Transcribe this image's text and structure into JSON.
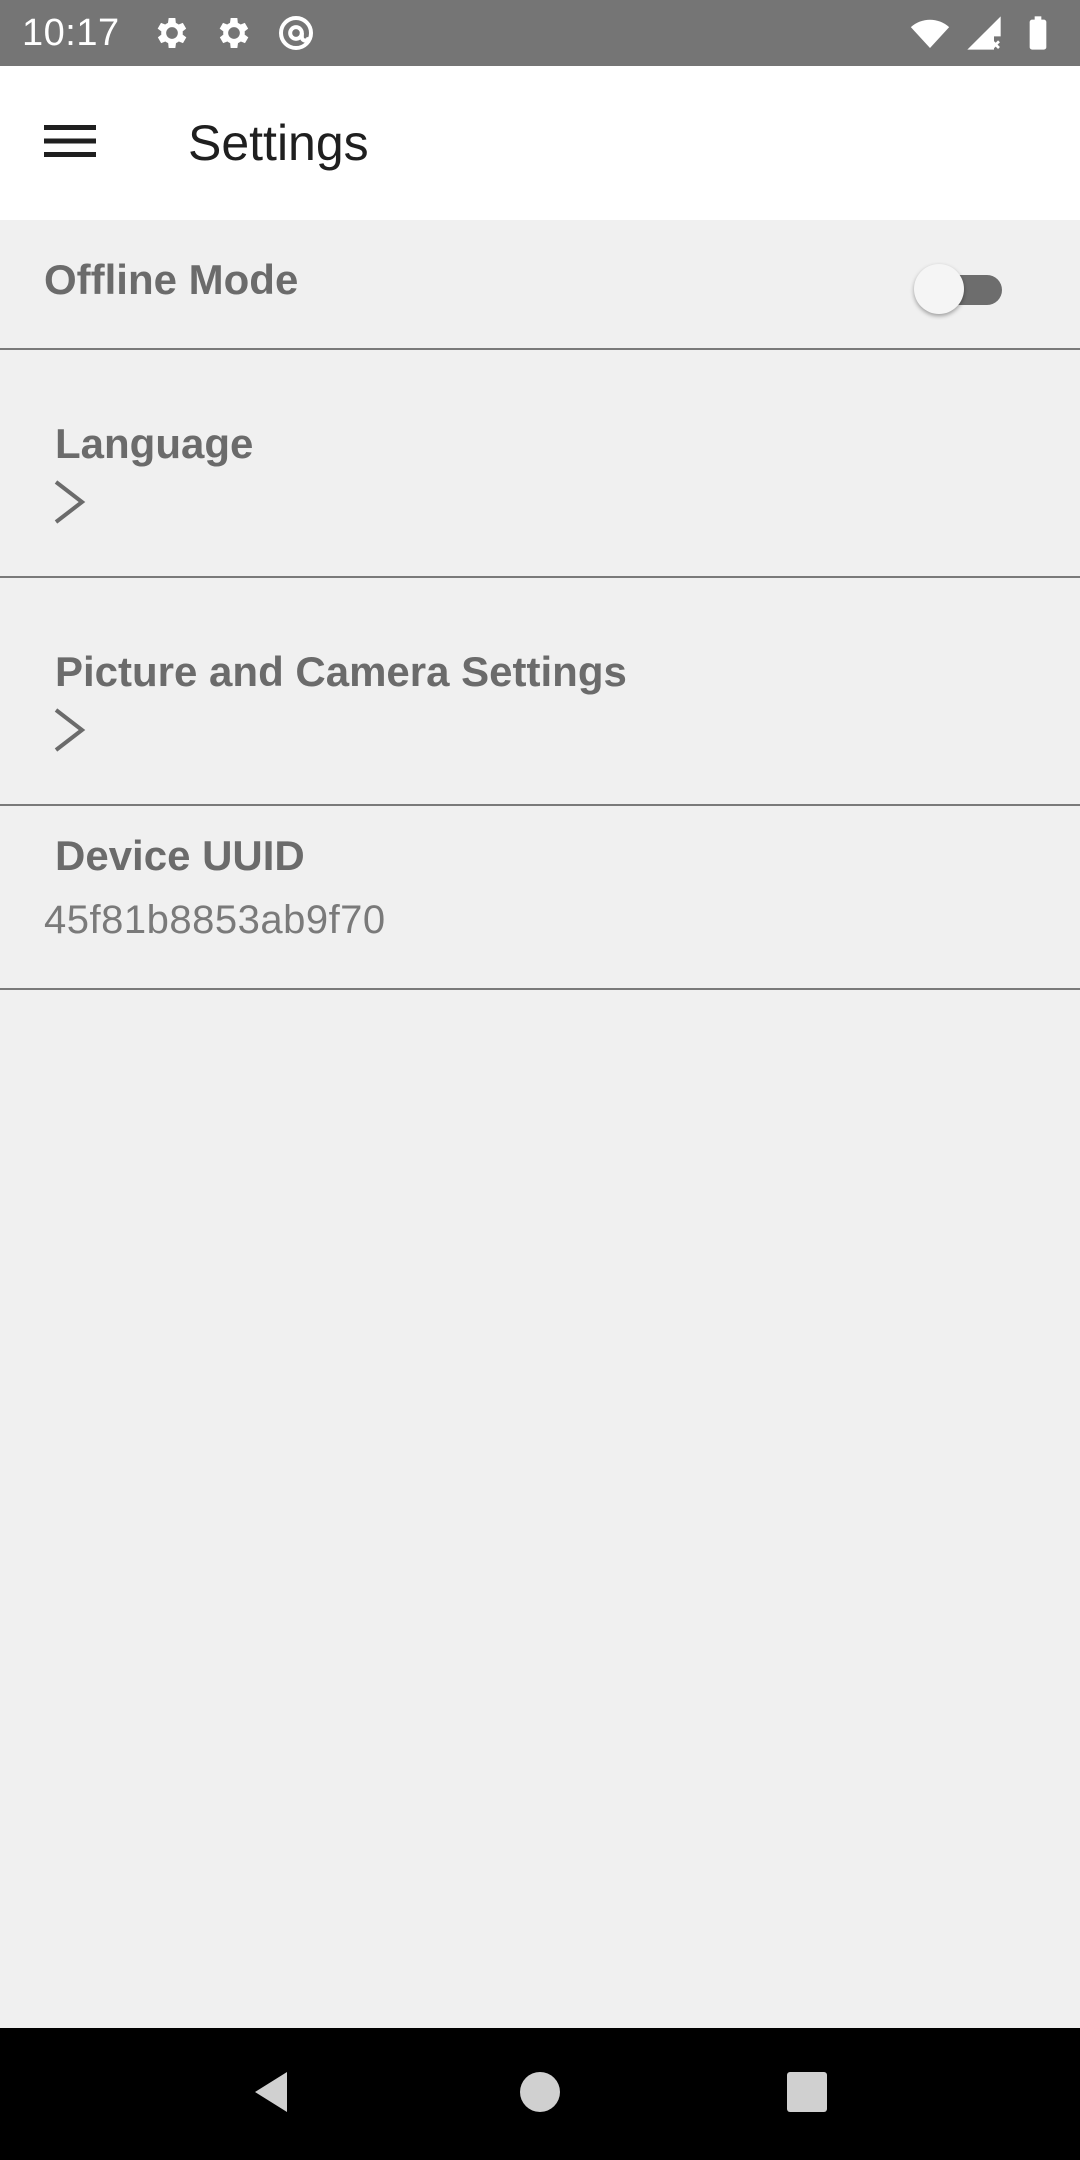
{
  "status_bar": {
    "time": "10:17",
    "left_icons": [
      "gear-icon",
      "gear-icon",
      "at-sign-icon"
    ],
    "right_icons": [
      "wifi-icon",
      "cell-signal-icon",
      "battery-icon"
    ],
    "background": "#757575"
  },
  "app_bar": {
    "title": "Settings",
    "menu_icon": "hamburger-menu-icon"
  },
  "settings": {
    "offline_mode": {
      "label": "Offline Mode",
      "enabled": false
    },
    "language": {
      "label": "Language",
      "icon": "chevron-right-icon"
    },
    "picture_camera": {
      "label": "Picture and Camera Settings",
      "icon": "chevron-right-icon"
    },
    "device_uuid": {
      "label": "Device UUID",
      "value": "45f81b8853ab9f70"
    }
  },
  "nav_bar": {
    "buttons": [
      "back-icon",
      "home-icon",
      "recents-icon"
    ]
  },
  "colors": {
    "list_background": "#f0f0f0",
    "label_text": "#6b6b6b",
    "divider": "#7a7a7a"
  }
}
